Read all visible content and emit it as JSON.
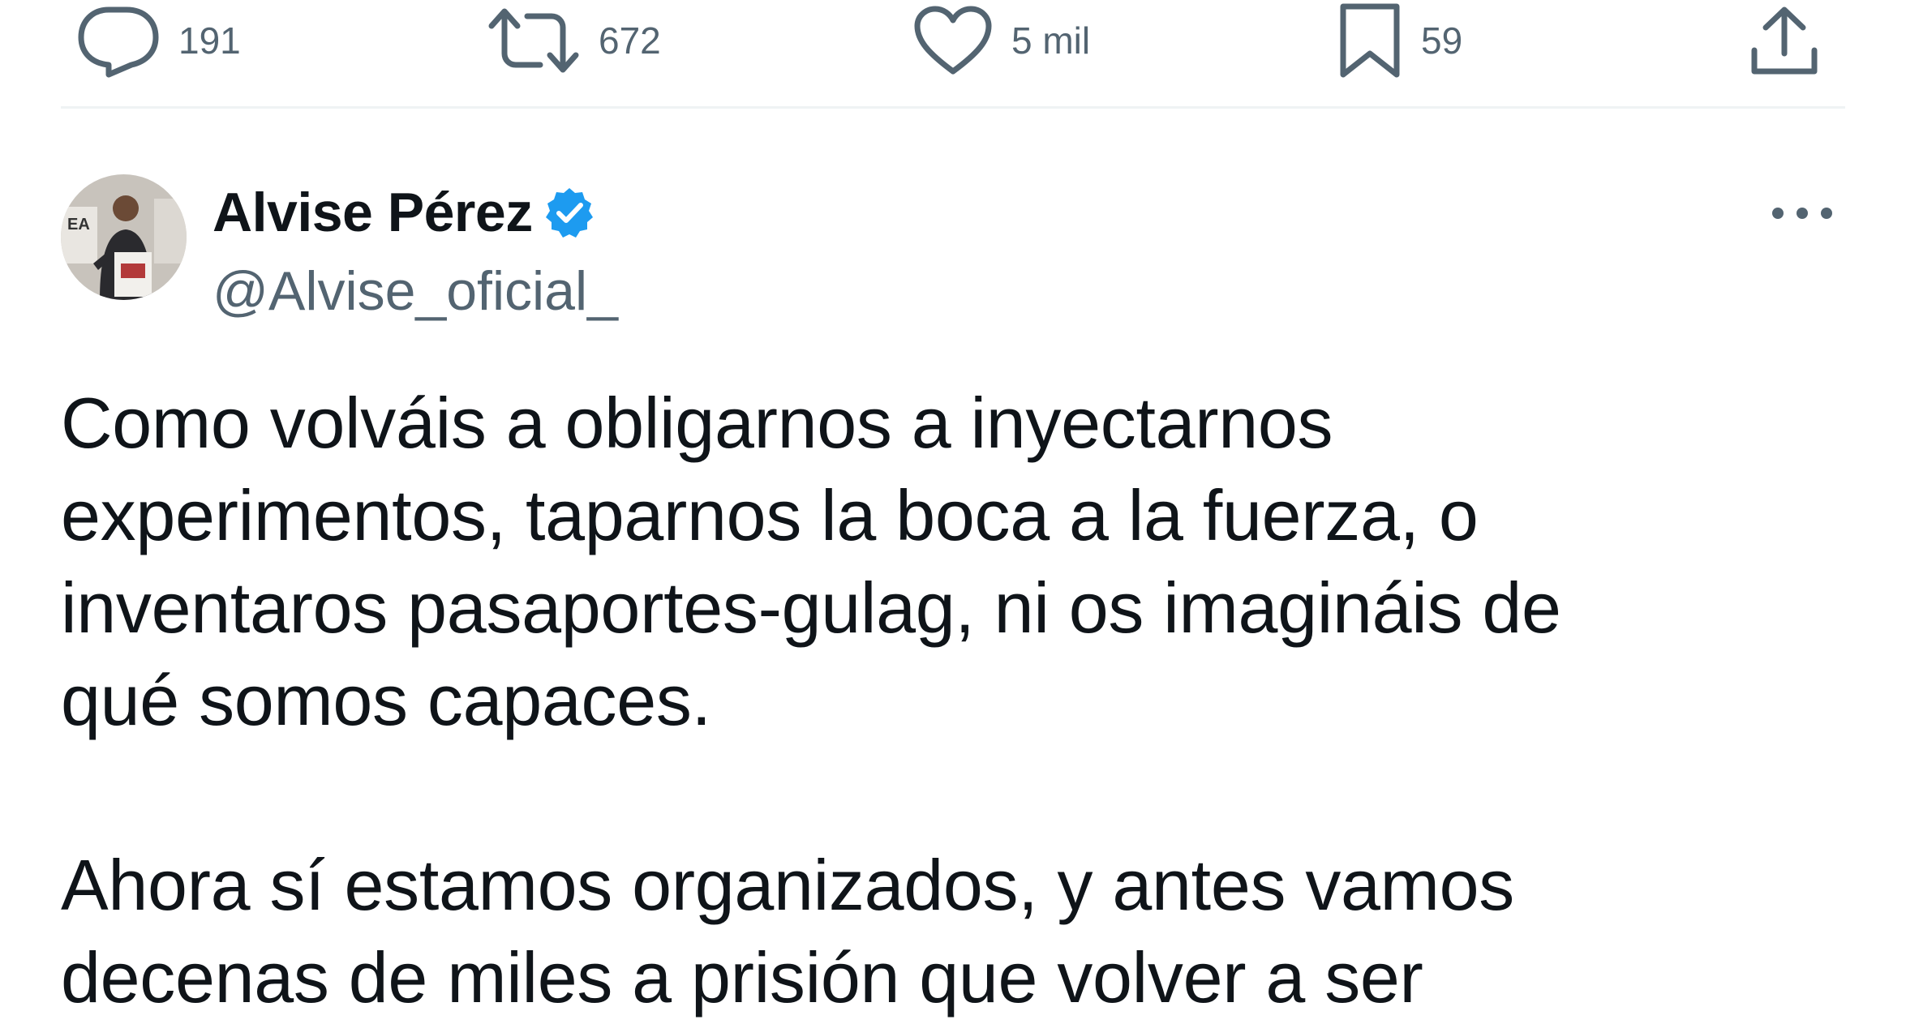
{
  "previous_tweet_actions": {
    "reply": {
      "icon": "reply-icon",
      "count": "191"
    },
    "retweet": {
      "icon": "retweet-icon",
      "count": "672"
    },
    "like": {
      "icon": "heart-icon",
      "count": "5 mil"
    },
    "bookmark": {
      "icon": "bookmark-icon",
      "count": "59"
    },
    "share": {
      "icon": "share-icon"
    }
  },
  "tweet": {
    "author": {
      "display_name": "Alvise Pérez",
      "handle": "@Alvise_oficial_",
      "verified": true,
      "verified_color": "#1d9bf0"
    },
    "more_icon": "more-options-icon",
    "text_lines": [
      "Como volváis a obligarnos a inyectarnos",
      "experimentos, taparnos la boca a la fuerza, o",
      "inventaros pasaportes-gulag, ni os imagináis de",
      "qué somos capaces.",
      "",
      "Ahora sí estamos organizados, y antes vamos",
      "decenas de miles a prisión que volver a ser"
    ]
  },
  "colors": {
    "text_primary": "#0f1419",
    "text_secondary": "#536471",
    "divider": "#eff3f4"
  }
}
